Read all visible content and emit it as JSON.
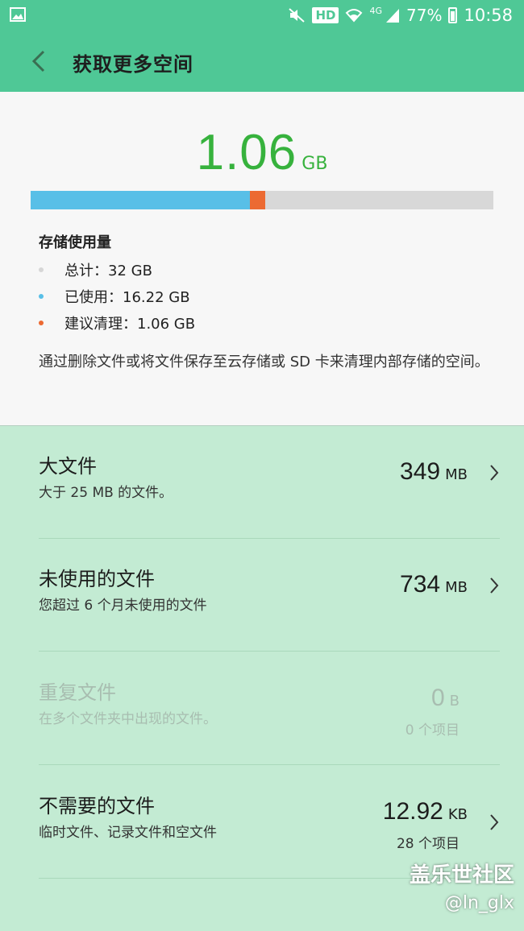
{
  "status_bar": {
    "hd_badge": "HD",
    "network": "4G",
    "battery": "77%",
    "time": "10:58"
  },
  "app_bar": {
    "title": "获取更多空间"
  },
  "summary": {
    "amount": "1.06",
    "unit": "GB",
    "usage_title": "存储使用量",
    "legend": [
      {
        "label": "总计：32 GB",
        "color": "#d6d6d6"
      },
      {
        "label": "已使用：16.22 GB",
        "color": "#58bfe7"
      },
      {
        "label": "建议清理：1.06 GB",
        "color": "#ec6a32"
      }
    ],
    "bar": {
      "total_gb": 32,
      "used_gb": 16.22,
      "suggested_gb": 1.06
    },
    "description": "通过删除文件或将文件保存至云存储或 SD 卡来清理内部存储的空间。"
  },
  "items": [
    {
      "name": "大文件",
      "sub": "大于 25 MB 的文件。",
      "value": "349",
      "unit": "MB",
      "count": ""
    },
    {
      "name": "未使用的文件",
      "sub": "您超过 6 个月未使用的文件",
      "value": "734",
      "unit": "MB",
      "count": ""
    },
    {
      "name": "重复文件",
      "sub": "在多个文件夹中出现的文件。",
      "value": "0",
      "unit": "B",
      "count": "0 个项目"
    },
    {
      "name": "不需要的文件",
      "sub": "临时文件、记录文件和空文件",
      "value": "12.92",
      "unit": "KB",
      "count": "28 个项目"
    }
  ],
  "watermark": {
    "line1": "盖乐世社区",
    "line2": "@ln_glx"
  },
  "colors": {
    "accent": "#4fc896",
    "total_text": "#37b23d",
    "list_bg": "#c3ebd3"
  }
}
